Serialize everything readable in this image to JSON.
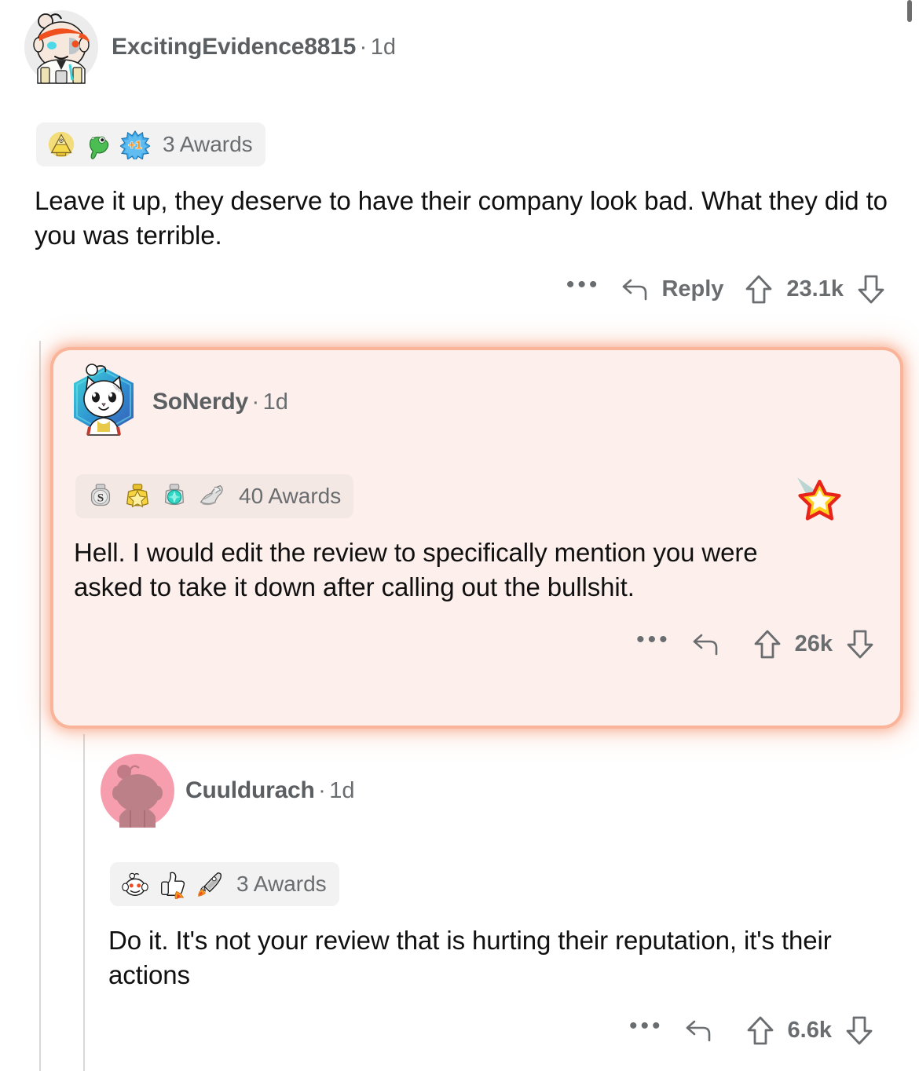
{
  "app": "reddit-comment-thread",
  "scrollbar": {
    "position": "top-right"
  },
  "comments": [
    {
      "id": "comment-1",
      "author": "ExcitingEvidence8815",
      "separator": "·",
      "age": "1d",
      "avatar_type": "snoo-cyborg-headband",
      "awards": {
        "count_label": "3 Awards",
        "icons": [
          "illuminati-pyramid-award",
          "dino-head-award",
          "plus-one-starburst-award"
        ]
      },
      "body": "Leave it up, they deserve to have their company look bad. What they did to you was terrible.",
      "actions": {
        "more_label": "•••",
        "reply_label": "Reply",
        "upvote_icon": "upvote-arrow-icon",
        "score": "23.1k",
        "downvote_icon": "downvote-arrow-icon"
      },
      "highlighted": false
    },
    {
      "id": "comment-2",
      "author": "SoNerdy",
      "separator": "·",
      "age": "1d",
      "avatar_type": "white-cat-hexagon",
      "awards": {
        "count_label": "40 Awards",
        "icons": [
          "silver-s-medal-award",
          "gold-star-medal-award",
          "teal-gem-medal-award",
          "arm-wrestle-medal-award"
        ]
      },
      "body": "Hell. I would edit the review to specifically mention you were asked to take it down after calling out the bullshit.",
      "actions": {
        "more_label": "•••",
        "reply_label": "",
        "upvote_icon": "upvote-arrow-icon",
        "score": "26k",
        "downvote_icon": "downvote-arrow-icon"
      },
      "highlighted": true,
      "badge": "shooting-star-award-badge"
    },
    {
      "id": "comment-3",
      "author": "Cuuldurach",
      "separator": "·",
      "age": "1d",
      "avatar_type": "pink-snoo-circle",
      "awards": {
        "count_label": "3 Awards",
        "icons": [
          "snoo-face-award",
          "thumbs-up-rocket-award",
          "rocket-award"
        ]
      },
      "body": "Do it. It's not your review that is hurting their reputation, it's their actions",
      "actions": {
        "more_label": "•••",
        "reply_label": "",
        "upvote_icon": "upvote-arrow-icon",
        "score": "6.6k",
        "downvote_icon": "downvote-arrow-icon"
      },
      "highlighted": false
    }
  ],
  "colors": {
    "highlight_bg": "#fdf0ec",
    "highlight_glow": "#f48256",
    "award_pill_bg": "#f2f2f2",
    "meta_text": "#6a6d70",
    "body_text": "#101010",
    "thread_line": "#d8d8d8",
    "scrollbar_thumb": "#6d6d6d"
  }
}
